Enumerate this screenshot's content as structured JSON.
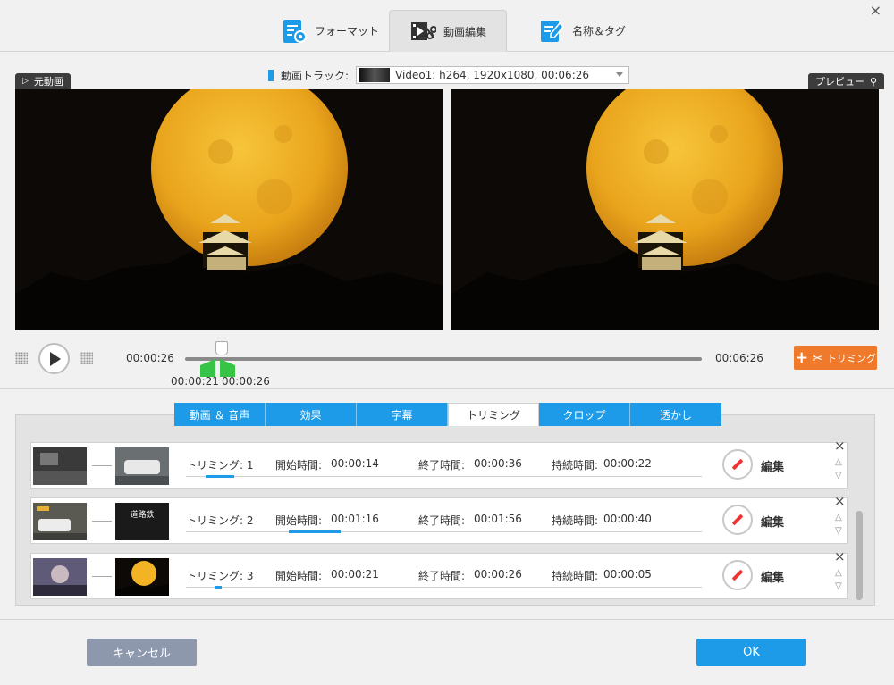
{
  "window": {
    "close_label": "×"
  },
  "top_tabs": [
    {
      "label": "フォーマット"
    },
    {
      "label": "動画編集"
    },
    {
      "label": "名称＆タグ"
    }
  ],
  "track": {
    "label": "動画トラック:",
    "value": "Video1: h264, 1920x1080, 00:06:26"
  },
  "source_tag": {
    "icon": "play-icon",
    "label": "元動画"
  },
  "preview_tag": {
    "label": "プレビュー",
    "icon": "search-icon"
  },
  "player": {
    "current_time": "00:00:26",
    "total_time": "00:06:26",
    "trim_start": "00:00:21",
    "trim_end": "00:00:26",
    "trim_button": "トリミング"
  },
  "edit_tabs": [
    {
      "label": "動画 ＆ 音声"
    },
    {
      "label": "効果"
    },
    {
      "label": "字幕"
    },
    {
      "label": "トリミング"
    },
    {
      "label": "クロップ"
    },
    {
      "label": "透かし"
    }
  ],
  "trims": [
    {
      "label": "トリミング: 1",
      "start_label": "開始時間:",
      "start": "00:00:14",
      "end_label": "終了時間:",
      "end": "00:00:36",
      "duration_label": "持続時間:",
      "duration": "00:00:22",
      "edit": "編集",
      "close": "×",
      "up": "△",
      "down": "▽"
    },
    {
      "label": "トリミング: 2",
      "start_label": "開始時間:",
      "start": "00:01:16",
      "end_label": "終了時間:",
      "end": "00:01:56",
      "duration_label": "持続時間:",
      "duration": "00:00:40",
      "edit": "編集",
      "close": "×",
      "up": "△",
      "down": "▽"
    },
    {
      "label": "トリミング: 3",
      "start_label": "開始時間:",
      "start": "00:00:21",
      "end_label": "終了時間:",
      "end": "00:00:26",
      "duration_label": "持続時間:",
      "duration": "00:00:05",
      "edit": "編集",
      "close": "×",
      "up": "△",
      "down": "▽"
    }
  ],
  "thumb_text": {
    "t2": "道路鉄"
  },
  "buttons": {
    "cancel": "キャンセル",
    "ok": "OK"
  },
  "colors": {
    "accent": "#1e9be8",
    "trim": "#f07a2b",
    "marker": "#35c446",
    "cancel": "#8e98ad",
    "moon": "#f2b424"
  }
}
